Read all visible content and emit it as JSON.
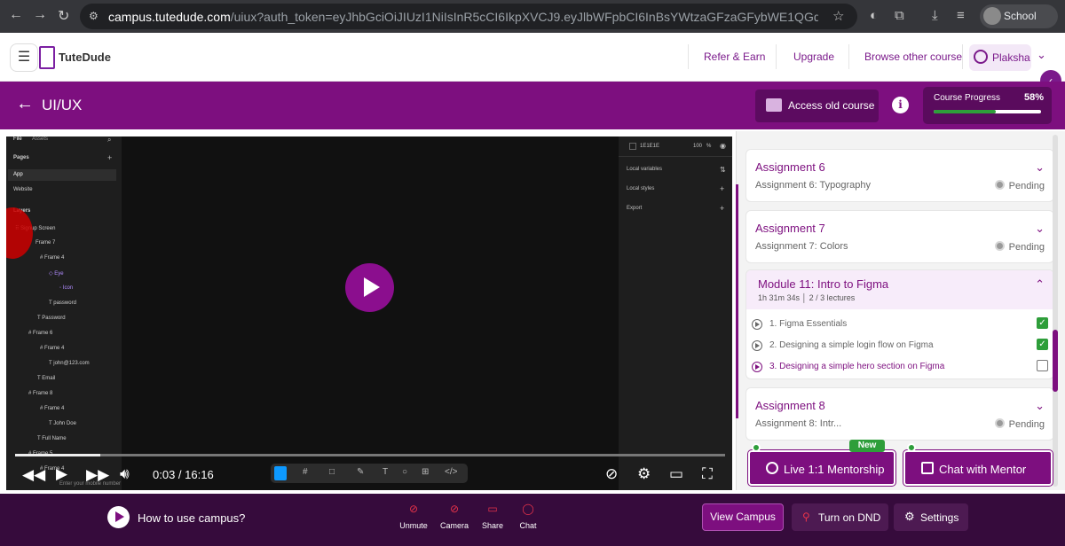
{
  "browser": {
    "url_host": "campus.tutedude.com",
    "url_rest": "/uiux?auth_token=eyJhbGciOiJIUzI1NiIsInR5cCI6IkpXVCJ9.eyJlbWFpbCI6InBsYWtzaGFzaGFybWE1QGdtYWlsLmNvbSIsIm5hbWUiOiJQbGFrc2hhI...",
    "profile_name": "School"
  },
  "header": {
    "logo_text": "TuteDude",
    "nav": [
      "Refer & Earn",
      "Upgrade",
      "Browse other course"
    ],
    "user_name": "Plaksha"
  },
  "course_bar": {
    "title": "UI/UX",
    "old_course_label": "Access old course",
    "progress_label": "Course Progress",
    "progress_text": "58%",
    "progress_value": 0.58
  },
  "video": {
    "time": "0:03 / 16:16",
    "played_fraction": 0.005,
    "figma_left": {
      "tabs": [
        "File",
        "Assets"
      ],
      "pages_label": "Pages",
      "pages": [
        "App",
        "Website"
      ],
      "layers_label": "Layers",
      "layers": [
        "Signup Screen",
        "Frame 7",
        "Frame 4",
        "Eye",
        "Icon",
        "password",
        "Password",
        "Frame 6",
        "Frame 4",
        "john@123.com",
        "Email",
        "Frame 8",
        "Frame 4",
        "John Doe",
        "Full Name",
        "Frame 5",
        "Frame 4",
        "Enter your mobile number"
      ]
    },
    "figma_right": {
      "fill_hex": "1E1E1E",
      "fill_opacity": "100",
      "fill_unit": "%",
      "rows": [
        "Local variables",
        "Local styles",
        "Export"
      ]
    }
  },
  "panel": {
    "assignments_top": [
      {
        "title": "Assignment 6",
        "sub": "Assignment 6: Typography",
        "status": "Pending"
      },
      {
        "title": "Assignment 7",
        "sub": "Assignment 7: Colors",
        "status": "Pending"
      }
    ],
    "module": {
      "title": "Module 11: Intro to Figma",
      "duration": "1h 31m 34s",
      "lectures_count": "2 / 3 lectures",
      "lectures": [
        {
          "label": "1. Figma Essentials",
          "done": true
        },
        {
          "label": "2. Designing a simple login flow on Figma",
          "done": true
        },
        {
          "label": "3. Designing a simple hero section on Figma",
          "done": false
        }
      ]
    },
    "assignment_bottom": {
      "title": "Assignment 8",
      "sub": "Assignment 8: Intr...",
      "status": "Pending"
    }
  },
  "mentor": {
    "live_label": "Live 1:1 Mentorship",
    "new_badge": "New",
    "chat_label": "Chat with Mentor"
  },
  "bottom_bar": {
    "howto": "How to use campus?",
    "call_buttons": [
      "Unmute",
      "Camera",
      "Share",
      "Chat"
    ],
    "view_campus": "View Campus",
    "dnd": "Turn on DND",
    "settings": "Settings"
  }
}
